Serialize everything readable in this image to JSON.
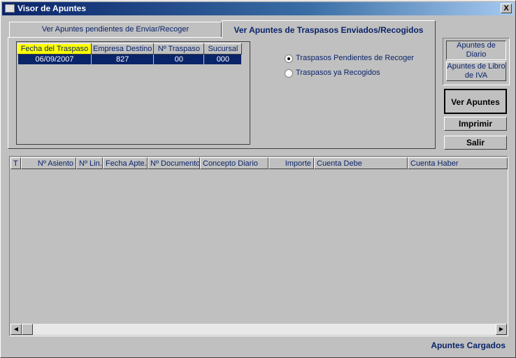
{
  "window": {
    "title": "Visor de Apuntes",
    "close_label": "X"
  },
  "tabs": [
    {
      "label": "Ver Apuntes pendientes de Enviar/Recoger"
    },
    {
      "label": "Ver Apuntes de Traspasos Enviados/Recogidos"
    }
  ],
  "traspasos_grid": {
    "columns": [
      "Fecha del Traspaso",
      "Empresa Destino",
      "Nº Traspaso",
      "Sucursal"
    ],
    "rows": [
      [
        "06/09/2007",
        "827",
        "00",
        "000"
      ]
    ]
  },
  "radios": [
    {
      "label": "Traspasos Pendientes de Recoger",
      "checked": true
    },
    {
      "label": "Traspasos ya Recogidos",
      "checked": false
    }
  ],
  "toggle_buttons": {
    "diario": "Apuntes de Diario",
    "iva": "Apuntes de Libro de IVA"
  },
  "buttons": {
    "ver": "Ver Apuntes",
    "imprimir": "Imprimir",
    "salir": "Salir"
  },
  "apuntes_grid": {
    "columns": [
      "T",
      "Nº Asiento",
      "Nº Lin.",
      "Fecha Apte.",
      "Nº Documento",
      "Concepto Diario",
      "Importe",
      "Cuenta Debe",
      "Cuenta Haber"
    ]
  },
  "scrollbar": {
    "left_arrow": "◀",
    "right_arrow": "▶"
  },
  "status": "Apuntes Cargados",
  "colors": {
    "titlebar": "#0a246a",
    "accent": "#0a246a",
    "selected_header": "#ffff00"
  }
}
